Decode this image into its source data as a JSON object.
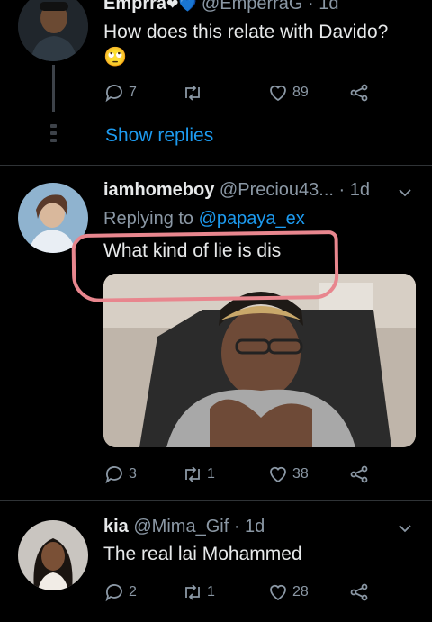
{
  "tweets": [
    {
      "name": "Emprra",
      "name_emoji": "❤💙",
      "handle": "@EmperraG",
      "time": "1d",
      "text": "How does this relate with Davido?",
      "text_emoji": "🙄",
      "replies": "7",
      "retweets": "",
      "likes": "89",
      "show_replies": "Show replies"
    },
    {
      "name": "iamhomeboy",
      "handle": "@Preciou43...",
      "time": "1d",
      "replying_prefix": "Replying to",
      "replying_to": "@papaya_ex",
      "text": "What kind of lie is dis",
      "replies": "3",
      "retweets": "1",
      "likes": "38"
    },
    {
      "name": "kia",
      "handle": "@Mima_Gif",
      "time": "1d",
      "text": "The real lai Mohammed",
      "replies": "2",
      "retweets": "1",
      "likes": "28"
    }
  ],
  "separator": "·",
  "icons": {
    "reply": "reply-icon",
    "retweet": "retweet-icon",
    "like": "heart-icon",
    "share": "share-icon",
    "more": "chevron-down-icon"
  },
  "colors": {
    "background": "#000000",
    "link": "#1d9bf0",
    "muted": "#8b98a5",
    "highlight": "#e8868e"
  }
}
